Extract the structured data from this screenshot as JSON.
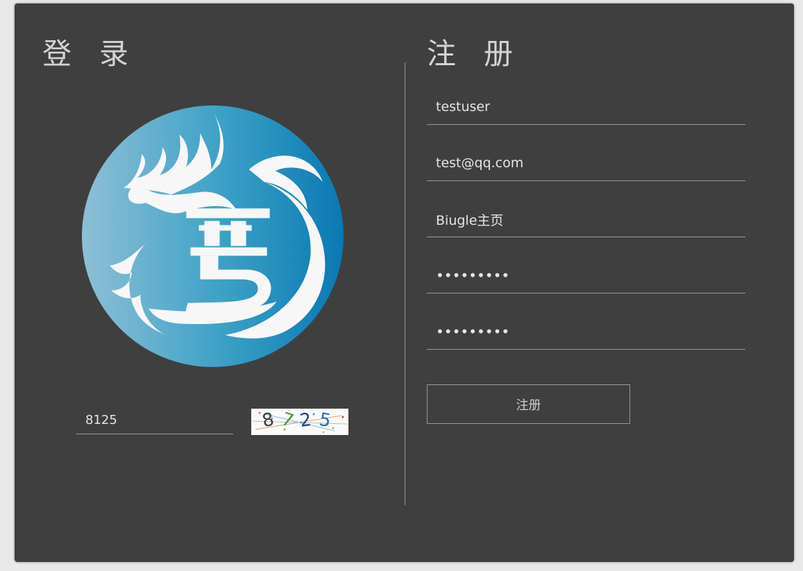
{
  "login": {
    "heading": "登录",
    "captcha_value": "8125",
    "captcha_image_digits": [
      "8",
      "7",
      "2",
      "5"
    ]
  },
  "register": {
    "heading": "注册",
    "username_value": "testuser",
    "email_value": "test@qq.com",
    "homepage_value": "Biugle主页",
    "password_value": "•••••••••",
    "confirm_password_value": "•••••••••",
    "submit_label": "注册"
  },
  "colors": {
    "panel": "#3f3f3f",
    "text": "#d4d4d4",
    "line": "#9a9a9a",
    "logo_gradient_start": "#8ebfd6",
    "logo_gradient_end": "#0d7db5"
  },
  "icons": {
    "logo": "dragon-logo-icon"
  }
}
